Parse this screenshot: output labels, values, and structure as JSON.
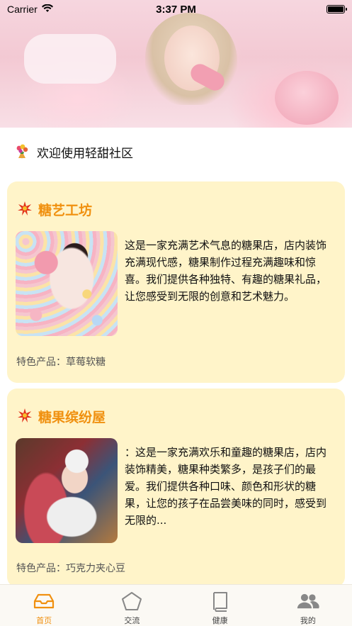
{
  "status_bar": {
    "carrier": "Carrier",
    "time": "3:37 PM"
  },
  "welcome": {
    "icon": "flower-bouquet-icon",
    "text": "欢迎使用轻甜社区"
  },
  "cards": [
    {
      "title": "糖艺工坊",
      "icon": "sparkle-icon",
      "description": "这是一家充满艺术气息的糖果店，店内装饰充满现代感，糖果制作过程充满趣味和惊喜。我们提供各种独特、有趣的糖果礼品，让您感受到无限的创意和艺术魅力。",
      "feature": "特色产品：草莓软糖"
    },
    {
      "title": "糖果缤纷屋",
      "icon": "sparkle-icon",
      "description": "：这是一家充满欢乐和童趣的糖果店，店内装饰精美，糖果种类繁多，是孩子们的最爱。我们提供各种口味、颜色和形状的糖果，让您的孩子在品尝美味的同时，感受到无限的...",
      "feature": "特色产品：巧克力夹心豆"
    }
  ],
  "tabs": [
    {
      "label": "首页",
      "icon": "inbox-tray-icon",
      "active": true
    },
    {
      "label": "交流",
      "icon": "pentagon-icon",
      "active": false
    },
    {
      "label": "健康",
      "icon": "book-icon",
      "active": false
    },
    {
      "label": "我的",
      "icon": "people-icon",
      "active": false
    }
  ],
  "colors": {
    "accent": "#f0900f",
    "card_bg": "#fff4c9",
    "tab_inactive": "#888888"
  }
}
